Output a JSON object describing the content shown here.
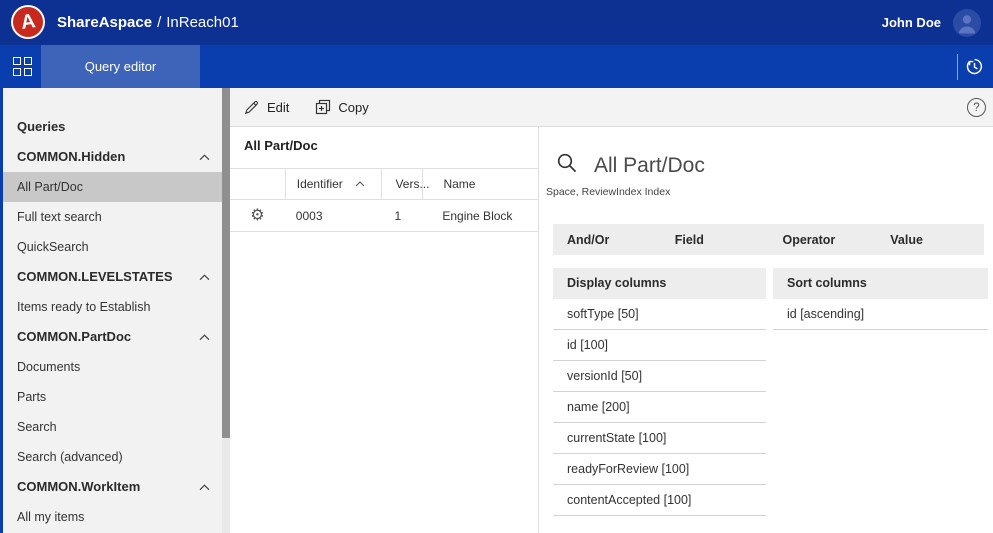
{
  "colors": {
    "topbar": "#0d3093",
    "navbar": "#0a3dad",
    "tab_active": "#3e64ba",
    "logo_red": "#c8281e",
    "sidebar_bg": "#f2f2f2",
    "sidebar_selected": "#c8c8c8",
    "section_header_bg": "#ededed"
  },
  "topbar": {
    "brand": "ShareAspace",
    "separator": "/",
    "space": "InReach01",
    "user": "John Doe"
  },
  "nav": {
    "tab": "Query editor"
  },
  "sidebar": {
    "title": "Queries",
    "groups": [
      {
        "label": "COMMON.Hidden",
        "items": [
          "All Part/Doc",
          "Full text search",
          "QuickSearch"
        ]
      },
      {
        "label": "COMMON.LEVELSTATES",
        "items": [
          "Items ready to Establish"
        ]
      },
      {
        "label": "COMMON.PartDoc",
        "items": [
          "Documents",
          "Parts",
          "Search",
          "Search (advanced)"
        ]
      },
      {
        "label": "COMMON.WorkItem",
        "items": [
          "All my items"
        ]
      }
    ],
    "selected_item": "All Part/Doc"
  },
  "toolbar": {
    "edit": "Edit",
    "copy": "Copy",
    "help_glyph": "?"
  },
  "results": {
    "title": "All Part/Doc",
    "columns": {
      "identifier": "Identifier",
      "version": "Vers...",
      "name": "Name"
    },
    "rows": [
      {
        "identifier": "0003",
        "version": "1",
        "name": "Engine Block"
      }
    ]
  },
  "query": {
    "title": "All Part/Doc",
    "subtitle": "Space, ReviewIndex Index",
    "condition_columns": [
      "And/Or",
      "Field",
      "Operator",
      "Value"
    ],
    "display": {
      "header": "Display columns",
      "items": [
        "softType [50]",
        "id [100]",
        "versionId [50]",
        "name [200]",
        "currentState [100]",
        "readyForReview [100]",
        "contentAccepted [100]"
      ]
    },
    "sort": {
      "header": "Sort columns",
      "items": [
        "id [ascending]"
      ]
    }
  },
  "icons": {
    "gear": "⚙",
    "logo_letter": "A"
  }
}
